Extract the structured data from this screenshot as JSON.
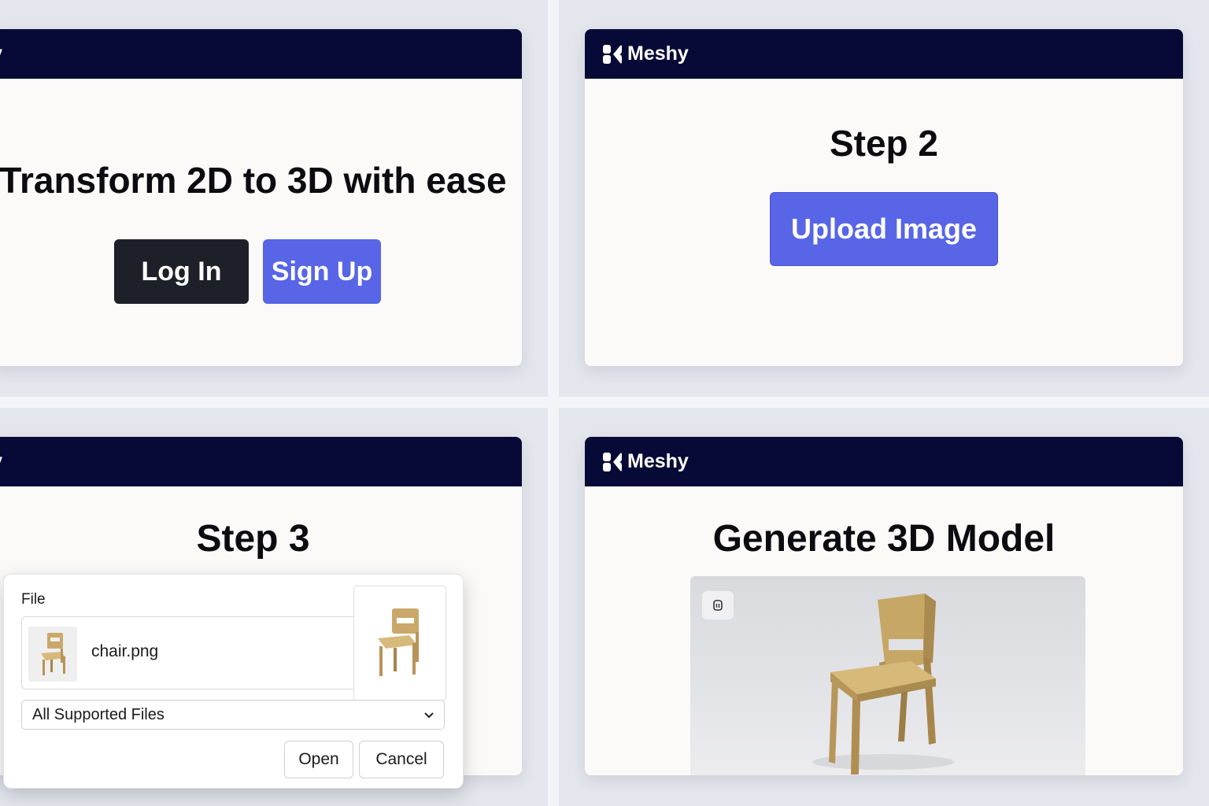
{
  "brand": {
    "name": "Meshy"
  },
  "panel_1": {
    "brand_partial": "eshy",
    "headline": "Transform 2D to 3D with ease",
    "login_label": "Log In",
    "signup_label": "Sign Up"
  },
  "panel_2": {
    "headline": "Step 2",
    "upload_label": "Upload Image"
  },
  "panel_3": {
    "brand_partial": "eshy",
    "headline": "Step 3",
    "dialog": {
      "file_label": "File",
      "file_name": "chair.png",
      "file_type": "All Supported Files",
      "open_label": "Open",
      "cancel_label": "Cancel"
    }
  },
  "panel_4": {
    "headline": "Generate 3D Model"
  },
  "colors": {
    "header": "#070a36",
    "accent": "#5765e6",
    "dark_button": "#1d2028",
    "chair": "#c9a86a"
  },
  "icons": [
    "meshy-logo-icon",
    "chevron-down-icon",
    "viewer-toggle-icon",
    "chair-image"
  ]
}
